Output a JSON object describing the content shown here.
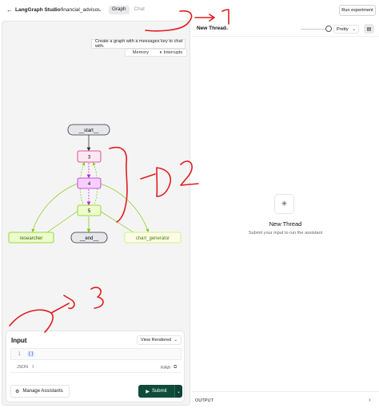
{
  "topbar": {
    "app_title": "LangGraph Studio",
    "separator": "/",
    "project": "financial_advisor",
    "tabs": [
      "Graph",
      "Chat"
    ],
    "run_experiment": "Run experiment"
  },
  "graph_panel": {
    "tooltip": "Create a graph with a messages key to chat with.",
    "toggles": [
      "Memory",
      "Interrupts"
    ],
    "nodes": {
      "start": "__start__",
      "n3": "3",
      "n4": "4",
      "n5": "5",
      "researcher": "researcher",
      "end": "__end__",
      "chart_generator": "chart_generator"
    }
  },
  "input_panel": {
    "label": "Input",
    "view_mode": "View Rendered",
    "line_number": "1",
    "code": "{}",
    "format": "JSON",
    "raw": "RAW",
    "manage_assistants": "Manage Assistants",
    "submit": "Submit"
  },
  "thread_panel": {
    "title": "New Thread",
    "view": "Pretty",
    "empty_title": "New Thread",
    "empty_subtitle": "Submit your input to run the assistant",
    "output": "OUTPUT"
  },
  "annotations": [
    "1",
    "2",
    "3"
  ]
}
